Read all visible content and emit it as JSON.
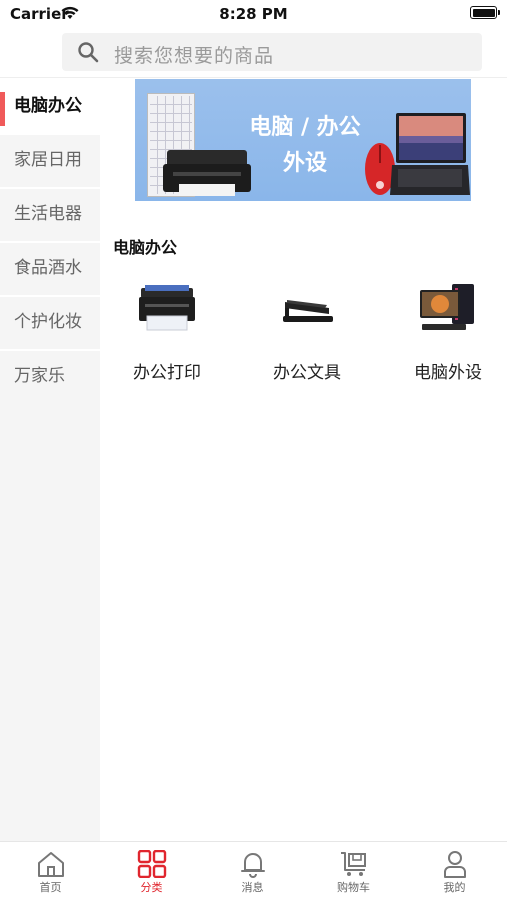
{
  "status_bar": {
    "carrier": "Carrier",
    "time": "8:28 PM"
  },
  "search": {
    "placeholder": "搜索您想要的商品"
  },
  "sidebar": {
    "items": [
      {
        "label": "电脑办公",
        "active": true
      },
      {
        "label": "家居日用",
        "active": false
      },
      {
        "label": "生活电器",
        "active": false
      },
      {
        "label": "食品酒水",
        "active": false
      },
      {
        "label": "个护化妆",
        "active": false
      },
      {
        "label": "万家乐",
        "active": false
      }
    ]
  },
  "banner": {
    "line1": "电脑 / 办公",
    "line2": "外设"
  },
  "section": {
    "title": "电脑办公",
    "categories": [
      {
        "label": "办公打印",
        "icon": "printer-icon"
      },
      {
        "label": "办公文具",
        "icon": "stapler-icon"
      },
      {
        "label": "电脑外设",
        "icon": "desktop-computer-icon"
      }
    ]
  },
  "tabbar": {
    "items": [
      {
        "label": "首页",
        "icon": "home-icon",
        "active": false
      },
      {
        "label": "分类",
        "icon": "category-grid-icon",
        "active": true
      },
      {
        "label": "消息",
        "icon": "bell-icon",
        "active": false
      },
      {
        "label": "购物车",
        "icon": "cart-icon",
        "active": false
      },
      {
        "label": "我的",
        "icon": "user-icon",
        "active": false
      }
    ]
  },
  "colors": {
    "accent": "#e0262e",
    "sidebar_indicator": "#f05a5a",
    "sidebar_bg": "#f5f5f5"
  }
}
